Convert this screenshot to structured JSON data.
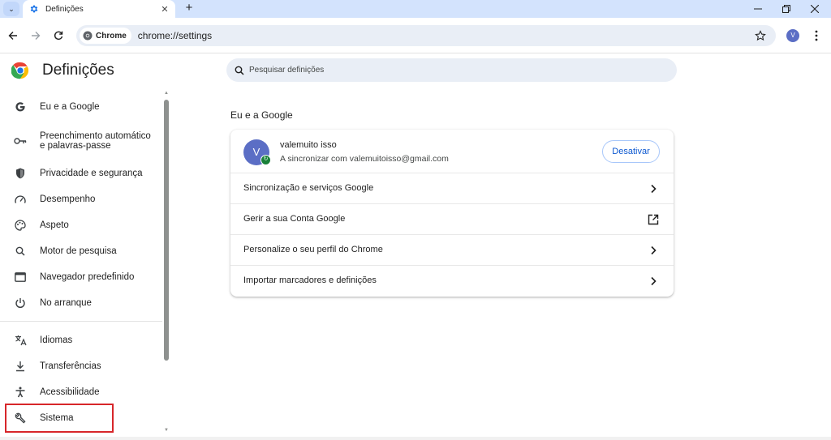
{
  "browser": {
    "tab": {
      "title": "Definições"
    },
    "address_bar": {
      "chip_label": "Chrome",
      "url": "chrome://settings"
    },
    "profile_initial": "V"
  },
  "settings": {
    "title": "Definições",
    "search_placeholder": "Pesquisar definições",
    "sidebar": {
      "items": [
        {
          "label": "Eu e a Google",
          "icon": "google-g-icon"
        },
        {
          "label": "Preenchimento automático e palavras-passe",
          "icon": "key-icon"
        },
        {
          "label": "Privacidade e segurança",
          "icon": "shield-icon"
        },
        {
          "label": "Desempenho",
          "icon": "speedometer-icon"
        },
        {
          "label": "Aspeto",
          "icon": "palette-icon"
        },
        {
          "label": "Motor de pesquisa",
          "icon": "search-icon"
        },
        {
          "label": "Navegador predefinido",
          "icon": "browser-window-icon"
        },
        {
          "label": "No arranque",
          "icon": "power-icon"
        },
        {
          "label": "Idiomas",
          "icon": "translate-icon"
        },
        {
          "label": "Transferências",
          "icon": "download-icon"
        },
        {
          "label": "Acessibilidade",
          "icon": "accessibility-icon"
        },
        {
          "label": "Sistema",
          "icon": "wrench-icon"
        }
      ],
      "highlighted": "Sistema",
      "highlight_color": "#d7262a"
    },
    "section": {
      "title": "Eu e a Google",
      "account": {
        "avatar_initial": "V",
        "name": "valemuito isso",
        "status": "A sincronizar com valemuitoisso@gmail.com",
        "button_label": "Desativar"
      },
      "rows": [
        {
          "label": "Sincronização e serviços Google",
          "icon": "chevron-right-icon"
        },
        {
          "label": "Gerir a sua Conta Google",
          "icon": "open-in-new-icon"
        },
        {
          "label": "Personalize o seu perfil do Chrome",
          "icon": "chevron-right-icon"
        },
        {
          "label": "Importar marcadores e definições",
          "icon": "chevron-right-icon"
        }
      ]
    }
  },
  "colors": {
    "accent": "#0b57d0",
    "tabstrip": "#d3e3fd",
    "avatar": "#5b6ec5",
    "sync_badge": "#188038"
  }
}
